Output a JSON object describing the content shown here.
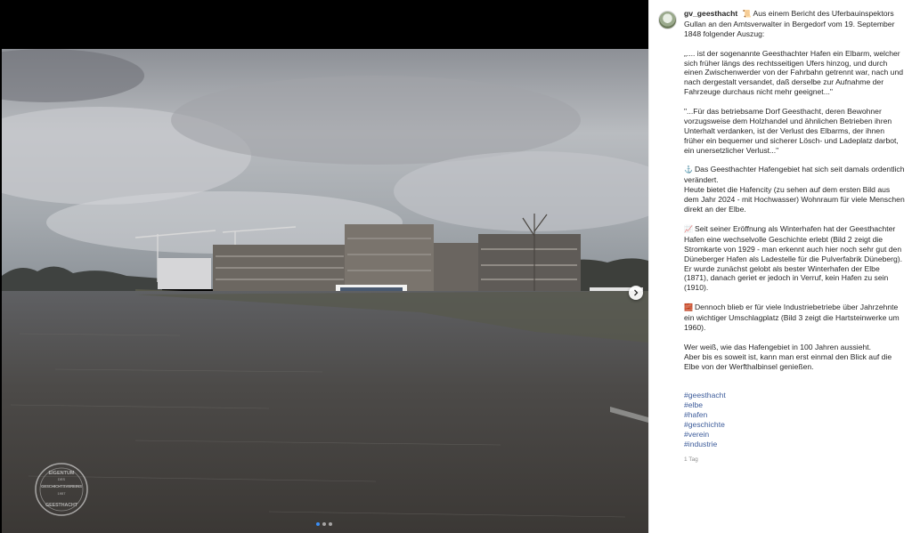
{
  "post": {
    "username": "gv_geesthacht",
    "intro": "Aus einem Bericht des Uferbauinspektors Gullan an den Amtsverwalter in Bergedorf vom 19. September 1848 folgender Auszug:",
    "quote1": "„.... ist der sogenannte Geesthachter Hafen ein Elbarm, welcher sich früher längs des rechtsseitigen Ufers hinzog, und durch einen Zwischenwerder von der Fahrbahn getrennt war, nach und nach dergestalt versandet, daß derselbe zur Aufnahme der Fahrzeuge durchaus nicht mehr geeignet...\"",
    "quote2": "\"...Für das betriebsame Dorf Geesthacht, deren Bewohner vorzugsweise dem Holzhandel und ähnlichen Betrieben ihren Unterhalt verdanken, ist der Verlust des Elbarms, der ihnen früher ein bequemer und sicherer Lösch- und Ladeplatz darbot, ein unersetzlicher Verlust...\"",
    "para_anchor": "Das Geesthachter Hafengebiet hat sich seit damals ordentlich verändert.\nHeute bietet die Hafencity (zu sehen auf dem ersten Bild aus dem Jahr 2024 - mit Hochwasser) Wohnraum für viele Menschen direkt an der Elbe.",
    "para_chart": "Seit seiner Eröffnung als Winterhafen hat der Geesthachter Hafen eine wechselvolle Geschichte erlebt (Bild 2 zeigt die Stromkarte von 1929 - man erkennt auch hier noch sehr gut den Düneberger Hafen als Ladestelle für die Pulverfabrik Düneberg). Er wurde zunächst gelobt als bester Winterhafen der Elbe (1871), danach geriet er jedoch in Verruf, kein Hafen zu sein (1910).",
    "para_brick": "Dennoch blieb er für viele Industriebetriebe über Jahrzehnte ein wichtiger Umschlagplatz (Bild 3 zeigt die Hartsteinwerke um 1960).",
    "closing": "Wer weiß, wie das Hafengebiet in 100 Jahren aussieht.\nAber bis es soweit ist, kann man erst einmal den Blick auf die Elbe von der Werfthalbinsel genießen.",
    "hashtags": [
      "#geesthacht",
      "#elbe",
      "#hafen",
      "#geschichte",
      "#verein",
      "#industrie"
    ],
    "timestamp": "1 Tag"
  },
  "icons": {
    "intro": "scroll-emoji-icon",
    "para_anchor": "anchor-emoji-icon",
    "para_chart": "chart-emoji-icon",
    "para_brick": "brick-emoji-icon"
  },
  "carousel": {
    "slide_count": 3,
    "active_index": 0,
    "accent_color": "#3b8ff5"
  },
  "watermark": {
    "line1": "EIGENTUM",
    "line2": "DES",
    "line3": "GESCHICHTSVEREINS",
    "line4": "1957",
    "line5": "GEESTHACHT"
  },
  "colors": {
    "text": "#262626",
    "hashtag": "#3c5b9a",
    "muted": "#8e8e8e"
  }
}
